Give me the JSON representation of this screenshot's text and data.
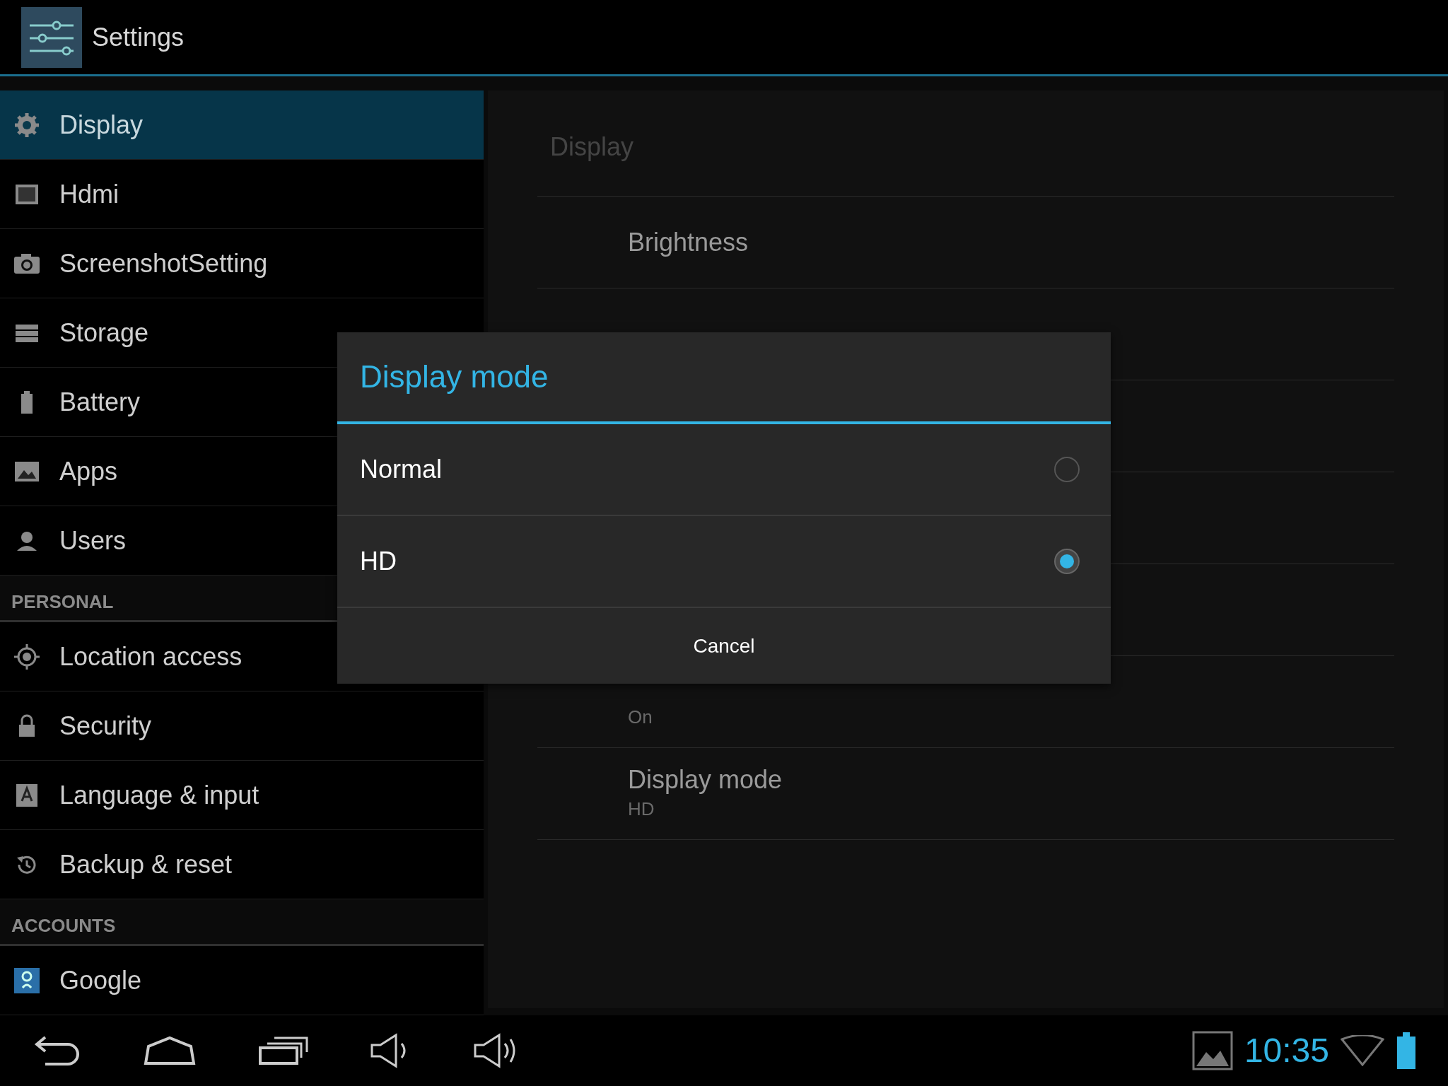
{
  "app_bar": {
    "title": "Settings"
  },
  "sidebar": {
    "items": [
      {
        "kind": "item",
        "label": "Display",
        "selected": true
      },
      {
        "kind": "item",
        "label": "Hdmi",
        "selected": false
      },
      {
        "kind": "item",
        "label": "ScreenshotSetting",
        "selected": false
      },
      {
        "kind": "item",
        "label": "Storage",
        "selected": false
      },
      {
        "kind": "item",
        "label": "Battery",
        "selected": false
      },
      {
        "kind": "item",
        "label": "Apps",
        "selected": false
      },
      {
        "kind": "item",
        "label": "Users",
        "selected": false
      },
      {
        "kind": "header",
        "label": "PERSONAL"
      },
      {
        "kind": "item",
        "label": "Location access",
        "selected": false
      },
      {
        "kind": "item",
        "label": "Security",
        "selected": false
      },
      {
        "kind": "item",
        "label": "Language & input",
        "selected": false
      },
      {
        "kind": "item",
        "label": "Backup & reset",
        "selected": false
      },
      {
        "kind": "header",
        "label": "ACCOUNTS"
      },
      {
        "kind": "item",
        "label": "Google",
        "selected": false
      }
    ]
  },
  "detail": {
    "header": "Display",
    "rows": [
      {
        "title": "Brightness"
      },
      {
        "summary": "On"
      },
      {
        "title": "Display mode",
        "summary": "HD"
      }
    ]
  },
  "dialog": {
    "title": "Display mode",
    "options": [
      {
        "label": "Normal",
        "selected": false
      },
      {
        "label": "HD",
        "selected": true
      }
    ],
    "cancel": "Cancel"
  },
  "nav_bar": {
    "clock": "10:35"
  }
}
